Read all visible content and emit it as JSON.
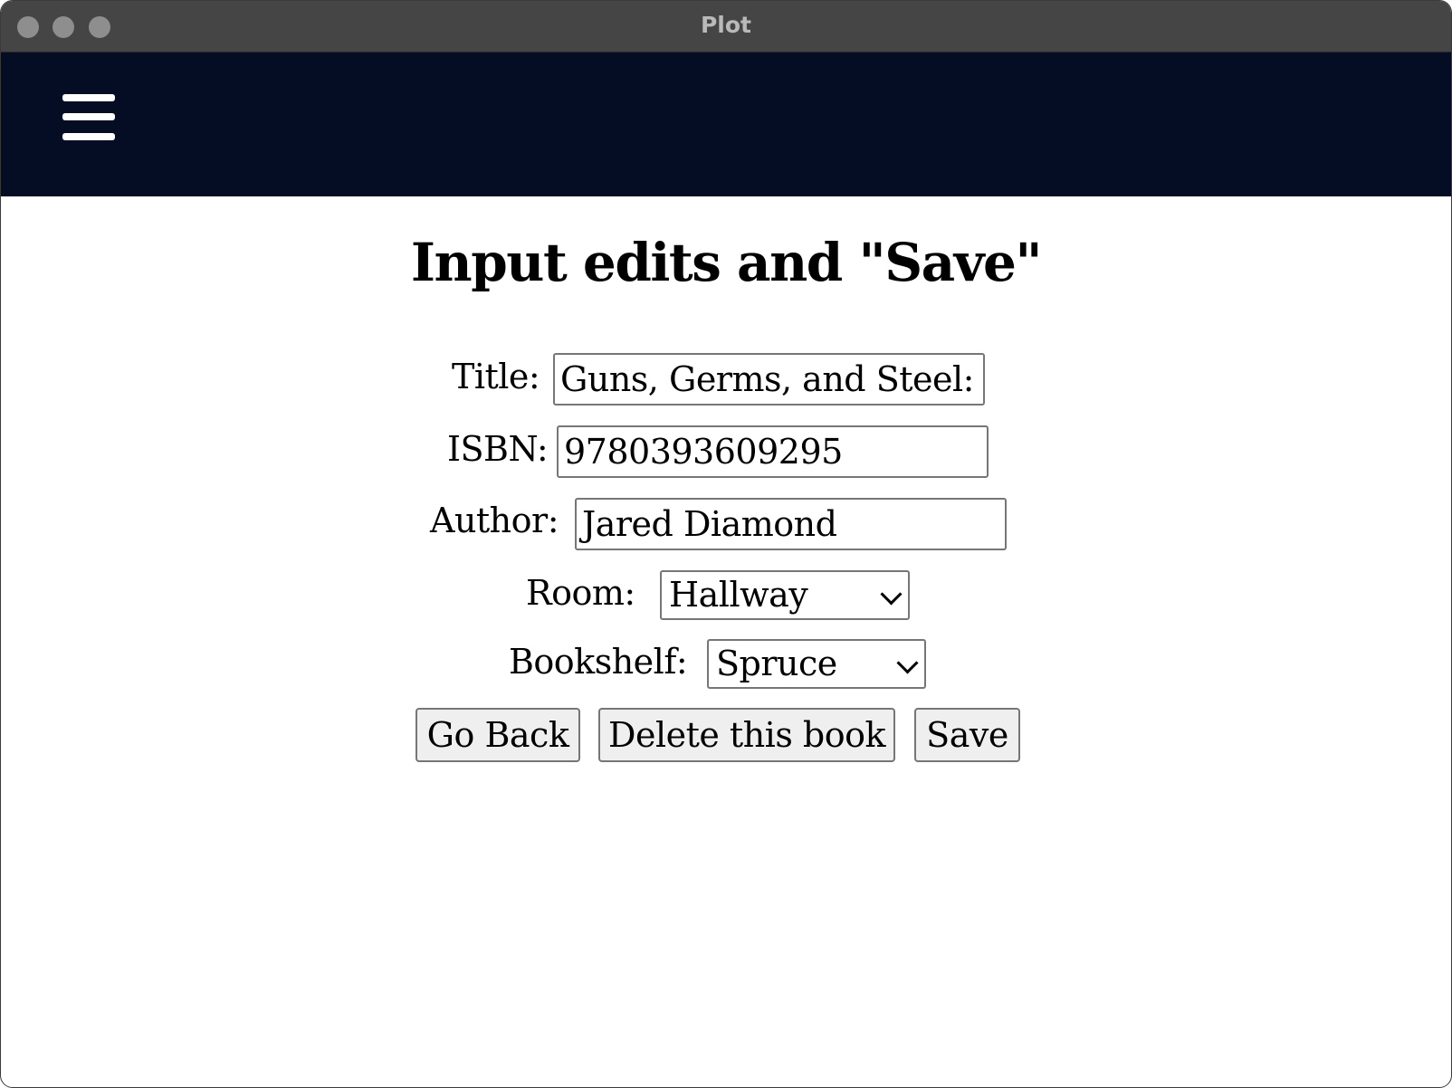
{
  "window": {
    "title": "Plot"
  },
  "navbar": {
    "menu_icon": "hamburger-menu-icon",
    "background": "#050d25"
  },
  "page": {
    "heading": "Input edits and \"Save\""
  },
  "form": {
    "title": {
      "label": "Title:",
      "value": "Guns, Germs, and Steel: T"
    },
    "isbn": {
      "label": "ISBN:",
      "value": "9780393609295"
    },
    "author": {
      "label": "Author:",
      "value": "Jared Diamond"
    },
    "room": {
      "label": "Room:",
      "selected": "Hallway"
    },
    "bookshelf": {
      "label": "Bookshelf:",
      "selected": "Spruce"
    }
  },
  "buttons": {
    "go_back": "Go Back",
    "delete": "Delete this book",
    "save": "Save"
  }
}
